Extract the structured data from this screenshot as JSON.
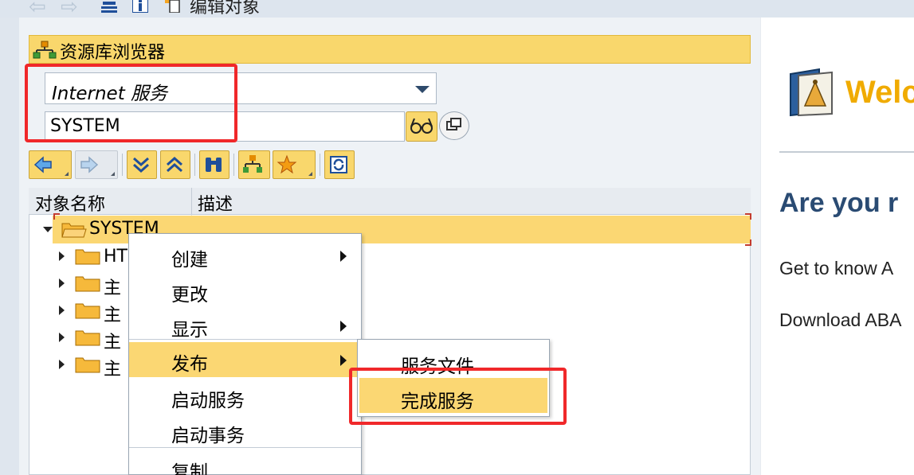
{
  "toolbar": {
    "back_icon": "back-arrow-icon",
    "forward_icon": "forward-arrow-icon",
    "edit_object_label": "编辑对象"
  },
  "repository_browser": {
    "title": "资源库浏览器",
    "object_type": "Internet 服务",
    "object_name": "SYSTEM"
  },
  "tree": {
    "columns": [
      "对象名称",
      "描述"
    ],
    "root": "SYSTEM",
    "children": [
      "HT",
      "主",
      "主",
      "主",
      "主"
    ]
  },
  "context_menu": {
    "items": [
      "创建",
      "更改",
      "显示",
      "发布",
      "启动服务",
      "启动事务",
      "复制..."
    ]
  },
  "publish_submenu": {
    "items": [
      "服务文件",
      "完成服务"
    ]
  },
  "welcome_panel": {
    "title": "Welc",
    "heading": "Are you r",
    "line1": "Get to know A",
    "line2": "Download ABA"
  },
  "colors": {
    "header_yellow": "#f9d76c",
    "highlight_red": "#f0282a",
    "welcome_orange": "#f0ab00",
    "heading_blue": "#2a4b73"
  }
}
